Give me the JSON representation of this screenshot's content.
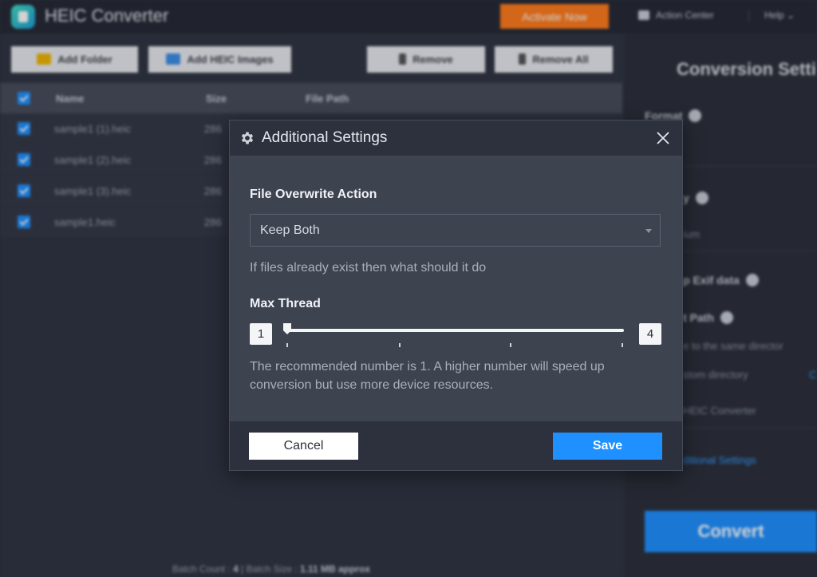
{
  "app": {
    "title": "HEIC Converter",
    "activate_label": "Activate Now",
    "action_center_label": "Action Center",
    "help_label": "Help ⌄"
  },
  "toolbar": {
    "add_folder": "Add Folder",
    "add_heic": "Add HEIC Images",
    "remove": "Remove",
    "remove_all": "Remove All"
  },
  "table": {
    "columns": [
      "Name",
      "Size",
      "File Path"
    ],
    "rows": [
      {
        "name": "sample1 (1).heic",
        "size": "286"
      },
      {
        "name": "sample1 (2).heic",
        "size": "286"
      },
      {
        "name": "sample1 (3).heic",
        "size": "286"
      },
      {
        "name": "sample1.heic",
        "size": "286"
      }
    ]
  },
  "status": {
    "batch_count_label": "Batch Count :",
    "batch_count": "4",
    "separator": "|",
    "batch_size_label": "Batch Size :",
    "batch_size": "1.11 MB approx"
  },
  "conversion": {
    "title": "Conversion Setti",
    "format_label": "Format",
    "quality_label": "y",
    "quality_value": "ium",
    "exif_label": "p Exif data",
    "output_label": "t Path",
    "same_dir": "e to the same director",
    "custom_dir": "stom directory",
    "custom_dir_link": "C",
    "path_value": "HEIC Converter",
    "additional_link": "ditional Settings",
    "convert_label": "Convert"
  },
  "dialog": {
    "title": "Additional Settings",
    "overwrite_label": "File Overwrite Action",
    "overwrite_value": "Keep Both",
    "overwrite_hint": "If files already exist then what should it do",
    "thread_label": "Max Thread",
    "thread_min": "1",
    "thread_max": "4",
    "thread_value": 1,
    "thread_hint_1": "The recommended number is 1. A higher number will speed up",
    "thread_hint_2": "conversion but use more device resources.",
    "cancel_label": "Cancel",
    "save_label": "Save"
  },
  "colors": {
    "accent": "#1e90ff",
    "activate": "#ff7a1a",
    "dialog_bg": "#3e4350"
  }
}
